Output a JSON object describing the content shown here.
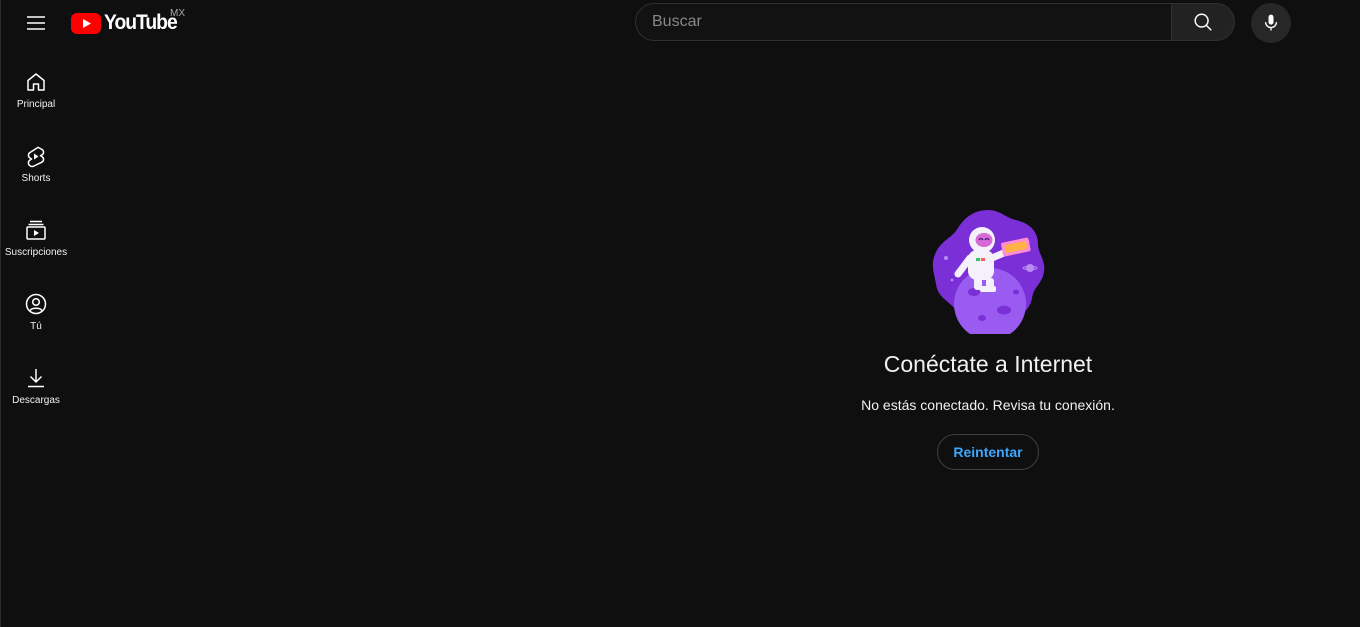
{
  "header": {
    "logo_text": "YouTube",
    "country_code": "MX",
    "search_placeholder": "Buscar"
  },
  "sidebar": {
    "items": [
      {
        "label": "Principal",
        "icon": "home-icon"
      },
      {
        "label": "Shorts",
        "icon": "shorts-icon"
      },
      {
        "label": "Suscripciones",
        "icon": "subscriptions-icon"
      },
      {
        "label": "Tú",
        "icon": "you-icon"
      },
      {
        "label": "Descargas",
        "icon": "downloads-icon"
      }
    ]
  },
  "offline": {
    "title": "Conéctate a Internet",
    "message": "No estás conectado. Revisa tu conexión.",
    "retry_label": "Reintentar",
    "illustration": "astronaut-on-planet-illustration"
  },
  "colors": {
    "background": "#0f0f0f",
    "brand_red": "#ff0000",
    "link_blue": "#3ea6ff",
    "illustration_purple": "#7b2fd6"
  }
}
